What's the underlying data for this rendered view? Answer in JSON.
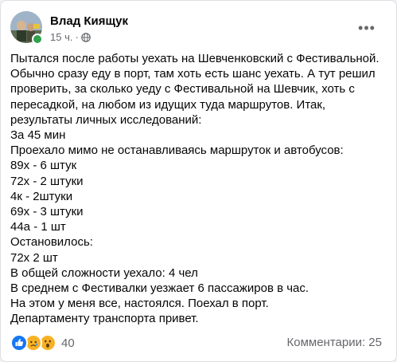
{
  "post": {
    "author": "Влад Киящук",
    "time": "15 ч.",
    "separator": "·",
    "more_label": "•••",
    "lines": [
      "Пытался после работы уехать на Шевченковский с Фестивальной.",
      "Обычно сразу еду в порт, там хоть есть шанс уехать. А тут решил",
      "проверить, за сколько уеду с Фестивальной на Шевчик, хоть с",
      "пересадкой, на любом из идущих туда маршрутов. Итак,",
      "результаты личных исследований:",
      "За 45 мин",
      "Проехало мимо не останавливаясь маршруток и автобусов:",
      "89х - 6 штук",
      "72х - 2 штуки",
      "4к - 2штуки",
      "69х - 3 штуки",
      "44а - 1 шт",
      "Остановилось:",
      "72х 2 шт",
      "В общей сложности уехало: 4 чел",
      "В среднем с Фестивалки уезжает 6 пассажиров в час.",
      "На этом у меня все, настоялся. Поехал в порт.",
      "Департаменту транспорта привет."
    ]
  },
  "footer": {
    "reaction_count": "40",
    "comments_label": "Комментарии: 25",
    "reaction_icons": [
      "like-icon",
      "sad-icon",
      "wow-icon"
    ]
  },
  "colors": {
    "text": "#050505",
    "secondary": "#65676b",
    "like": "#1877f2",
    "emoji": "#f7b125",
    "online": "#31a24c"
  }
}
